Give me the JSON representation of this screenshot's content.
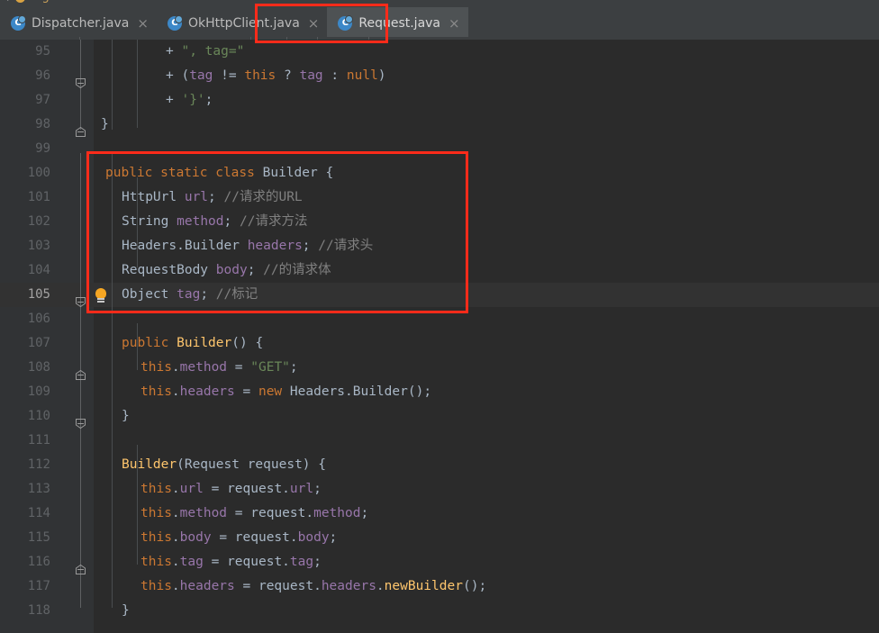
{
  "window": {
    "theme": "darcula",
    "background": "#2b2b2b",
    "gutter_background": "#313335",
    "accent": "#3c8ee0",
    "annotation_color": "#ff2b1a"
  },
  "breadcrumb": {
    "separator": "/",
    "last_label": "tag"
  },
  "tabs": [
    {
      "label": "Dispatcher.java",
      "icon": "java-class-icon",
      "close": "×",
      "active": false
    },
    {
      "label": "OkHttpClient.java",
      "icon": "java-class-icon",
      "close": "×",
      "active": false
    },
    {
      "label": "Request.java",
      "icon": "java-class-icon",
      "close": "×",
      "active": true
    }
  ],
  "editor": {
    "current_line": 105,
    "first_visible_line": 95,
    "last_visible_line": 118,
    "gutter_icon": "lightbulb-intention-icon",
    "lines": [
      {
        "n": 95,
        "text": "          + \", tag=\""
      },
      {
        "n": 96,
        "text": "          + (tag != this ? tag : null)"
      },
      {
        "n": 97,
        "text": "          + '}';"
      },
      {
        "n": 98,
        "text": "  }"
      },
      {
        "n": 99,
        "text": ""
      },
      {
        "n": 100,
        "text": "  public static class Builder {"
      },
      {
        "n": 101,
        "text": "    HttpUrl url; //请求的URL"
      },
      {
        "n": 102,
        "text": "    String method; //请求方法"
      },
      {
        "n": 103,
        "text": "    Headers.Builder headers; //请求头"
      },
      {
        "n": 104,
        "text": "    RequestBody body; //的请求体"
      },
      {
        "n": 105,
        "text": "    Object tag; //标记"
      },
      {
        "n": 106,
        "text": ""
      },
      {
        "n": 107,
        "text": "    public Builder() {"
      },
      {
        "n": 108,
        "text": "      this.method = \"GET\";"
      },
      {
        "n": 109,
        "text": "      this.headers = new Headers.Builder();"
      },
      {
        "n": 110,
        "text": "    }"
      },
      {
        "n": 111,
        "text": ""
      },
      {
        "n": 112,
        "text": "    Builder(Request request) {"
      },
      {
        "n": 113,
        "text": "      this.url = request.url;"
      },
      {
        "n": 114,
        "text": "      this.method = request.method;"
      },
      {
        "n": 115,
        "text": "      this.body = request.body;"
      },
      {
        "n": 116,
        "text": "      this.tag = request.tag;"
      },
      {
        "n": 117,
        "text": "      this.headers = request.headers.newBuilder();"
      },
      {
        "n": 118,
        "text": "    }"
      }
    ]
  },
  "annotations": [
    {
      "name": "active-tab-highlight",
      "note": "red rectangle around Request.java tab"
    },
    {
      "name": "builder-fields-highlight",
      "note": "red rectangle around Builder class field declarations"
    }
  ]
}
